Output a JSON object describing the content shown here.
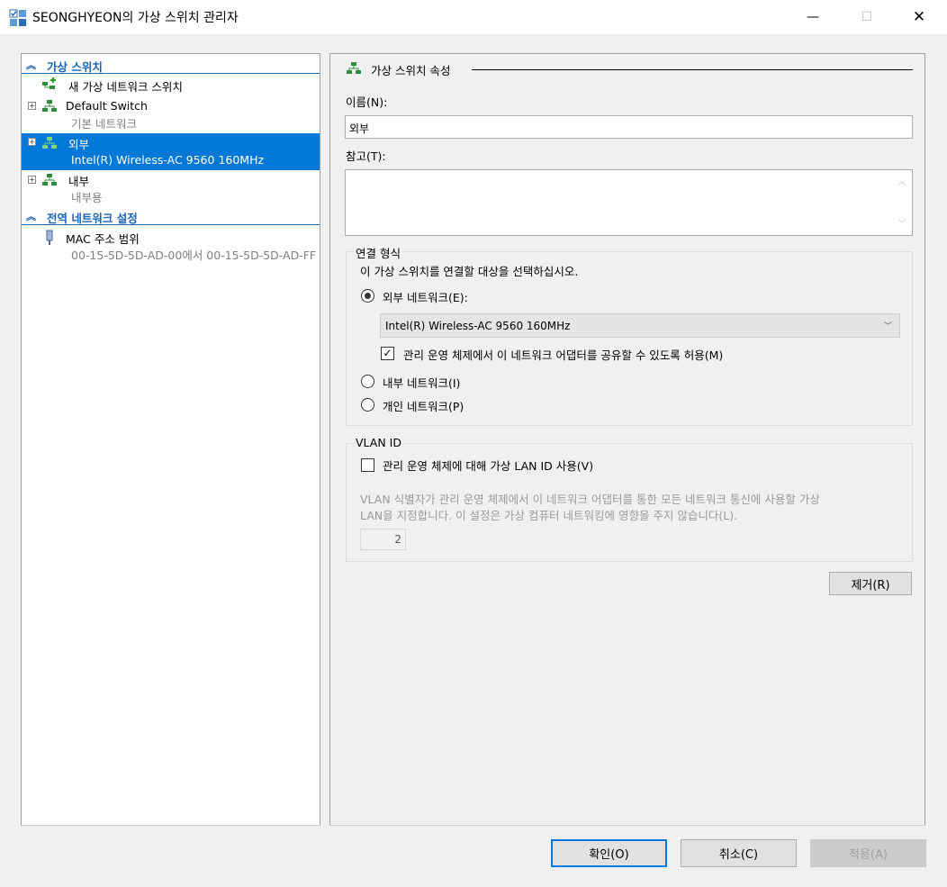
{
  "window": {
    "title": "SEONGHYEON의 가상 스위치 관리자",
    "minimize_glyph": "—",
    "maximize_glyph": "☐",
    "close_glyph": "✕"
  },
  "tree": {
    "category_virtual_switches": "가상 스위치",
    "new_switch": "새 가상 네트워크 스위치",
    "switches": [
      {
        "name": "Default Switch",
        "detail": "기본 네트워크"
      },
      {
        "name": "외부",
        "detail": "Intel(R) Wireless-AC 9560 160MHz"
      },
      {
        "name": "내부",
        "detail": "내부용"
      }
    ],
    "category_global": "전역 네트워크 설정",
    "mac_range_label": "MAC 주소 범위",
    "mac_range_value": "00-15-5D-5D-AD-00에서 00-15-5D-5D-AD-FF"
  },
  "properties": {
    "section_title": "가상 스위치 속성",
    "name_label": "이름(N):",
    "name_value": "외부",
    "notes_label": "참고(T):",
    "notes_value": "",
    "connection_group": "연결 형식",
    "connection_hint": "이 가상 스위치를 연결할 대상을 선택하십시오.",
    "external_label": "외부 네트워크(E):",
    "external_adapter": "Intel(R) Wireless-AC 9560 160MHz",
    "share_label": "관리 운영 체제에서 이 네트워크 어댑터를 공유할 수 있도록 허용(M)",
    "internal_label": "내부 네트워크(I)",
    "private_label": "개인 네트워크(P)",
    "vlan_group": "VLAN ID",
    "vlan_enable_label": "관리 운영 체제에 대해 가상 LAN ID 사용(V)",
    "vlan_desc_1": "VLAN 식별자가 관리 운영 체제에서 이 네트워크 어댑터를 통한 모든 네트워크 통신에 사용할 가상",
    "vlan_desc_2": "LAN을 지정합니다. 이 설정은 가상 컴퓨터 네트워킹에 영향을 주지 않습니다(L).",
    "vlan_value": "2",
    "remove_button": "제거(R)"
  },
  "footer": {
    "ok_button": "확인(O)",
    "cancel_button": "취소(C)",
    "apply_button": "적용(A)"
  },
  "state": {
    "selected_switch": "외부",
    "connection_type": "external",
    "share_checked": true,
    "vlan_checked": false
  },
  "colors": {
    "accent": "#0078d7",
    "category": "#1b63b5",
    "network_icon": "#2e8b3a"
  }
}
